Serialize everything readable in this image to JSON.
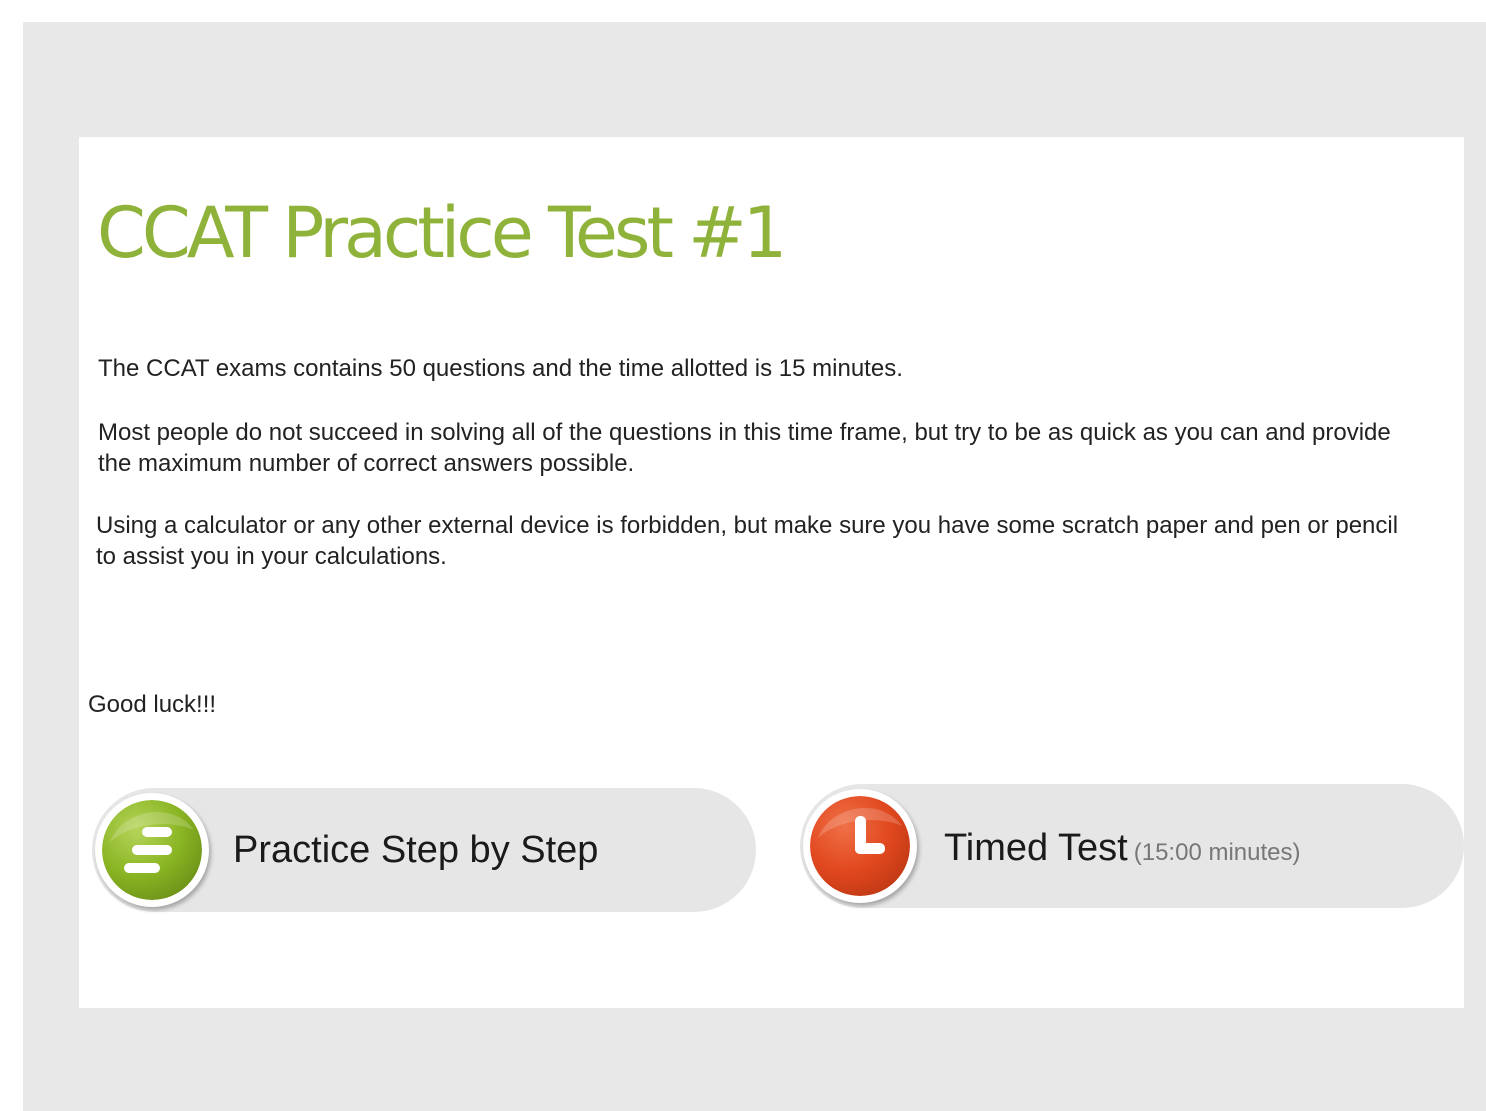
{
  "page": {
    "title": "CCAT Practice Test #1",
    "paragraphs": [
      "The CCAT exams contains 50 questions and the time allotted is 15 minutes.",
      "Most people do not succeed in solving all of the questions in this time frame, but try to be as quick as you can and provide the maximum number of correct answers possible.",
      "Using a calculator or any other external device is forbidden, but make sure you have some scratch paper and pen or pencil to assist you in your calculations."
    ],
    "closing": "Good luck!!!"
  },
  "buttons": {
    "practice": {
      "label": "Practice Step by Step",
      "icon": "list-lines-icon"
    },
    "timed": {
      "label": "Timed Test",
      "sublabel": "(15:00 minutes)",
      "icon": "clock-icon"
    }
  },
  "colors": {
    "title": "#8fb33a",
    "practice_badge": "#8ab523",
    "timed_badge": "#e1481f",
    "pill_background": "#e6e6e6",
    "frame_background": "#e8e8e8"
  }
}
